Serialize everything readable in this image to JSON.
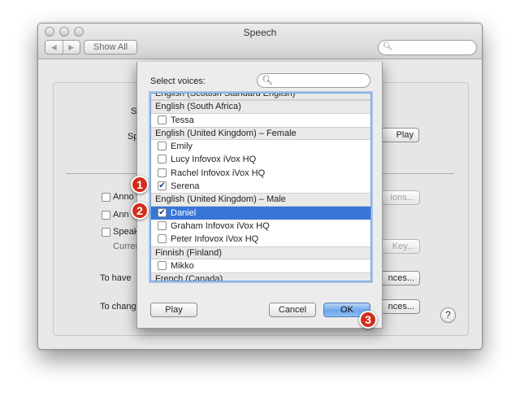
{
  "window": {
    "title": "Speech",
    "show_all": "Show All",
    "nav_back": "◀",
    "nav_forward": "▶"
  },
  "background": {
    "s_label": "S",
    "sp_label": "Sp",
    "play_btn": "Play",
    "check1": "Anno",
    "check2": "Ann",
    "check3": "Speak",
    "current_label": "Curren",
    "options_btn": "ions...",
    "key_btn": "Key...",
    "to_have": "To have",
    "to_change": "To change",
    "prefs_btn1": "nces...",
    "prefs_btn2": "nces...",
    "help": "?"
  },
  "sheet": {
    "label": "Select voices:",
    "play_button": "Play",
    "cancel_button": "Cancel",
    "ok_button": "OK",
    "list": [
      {
        "type": "header",
        "text": "English (Scottish Standard English)"
      },
      {
        "type": "header",
        "text": "English (South Africa)"
      },
      {
        "type": "item",
        "text": "Tessa",
        "checked": false,
        "selected": false
      },
      {
        "type": "header",
        "text": "English (United Kingdom) – Female"
      },
      {
        "type": "item",
        "text": "Emily",
        "checked": false,
        "selected": false
      },
      {
        "type": "item",
        "text": "Lucy Infovox iVox HQ",
        "checked": false,
        "selected": false
      },
      {
        "type": "item",
        "text": "Rachel Infovox iVox HQ",
        "checked": false,
        "selected": false
      },
      {
        "type": "item",
        "text": "Serena",
        "checked": true,
        "selected": false
      },
      {
        "type": "header",
        "text": "English (United Kingdom) – Male"
      },
      {
        "type": "item",
        "text": "Daniel",
        "checked": true,
        "selected": true
      },
      {
        "type": "item",
        "text": "Graham Infovox iVox HQ",
        "checked": false,
        "selected": false
      },
      {
        "type": "item",
        "text": "Peter Infovox iVox HQ",
        "checked": false,
        "selected": false
      },
      {
        "type": "header",
        "text": "Finnish (Finland)"
      },
      {
        "type": "item",
        "text": "Mikko",
        "checked": false,
        "selected": false
      },
      {
        "type": "header",
        "text": "French (Canada)"
      }
    ]
  },
  "badges": [
    "1",
    "2",
    "3"
  ],
  "colors": {
    "selection": "#3875d7",
    "badge": "#d22d1b"
  }
}
